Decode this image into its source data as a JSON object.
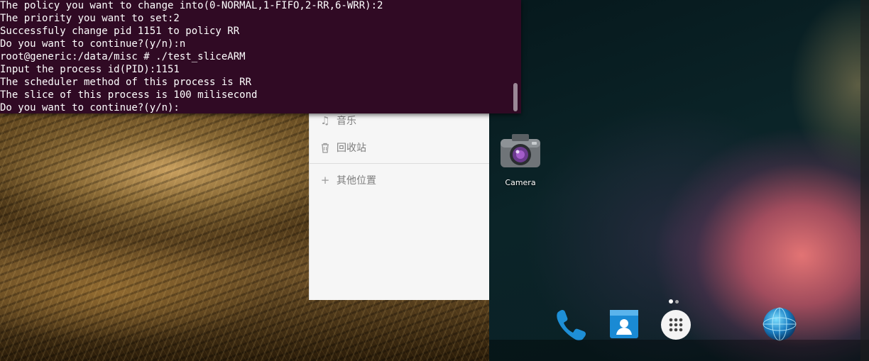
{
  "terminal": {
    "lines": [
      "The policy you want to change into(0-NORMAL,1-FIFO,2-RR,6-WRR):2",
      "The priority you want to set:2",
      "Successfuly change pid 1151 to policy RR",
      "Do you want to continue?(y/n):n",
      "root@generic:/data/misc # ./test_sliceARM",
      "Input the process id(PID):1151",
      "The scheduler method of this process is RR",
      "The slice of this process is 100 milisecond",
      "Do you want to continue?(y/n):"
    ],
    "background": "#300a24"
  },
  "file_manager": {
    "items": [
      {
        "label": "音乐",
        "icon": "music-note-icon"
      },
      {
        "label": "回收站",
        "icon": "trash-icon"
      },
      {
        "label": "其他位置",
        "icon": "plus-icon"
      }
    ]
  },
  "android": {
    "apps": [
      {
        "label": "Camera",
        "icon": "camera-icon"
      }
    ],
    "dock": [
      {
        "icon": "phone-icon"
      },
      {
        "icon": "contacts-icon"
      },
      {
        "icon": "all-apps-icon"
      },
      {
        "icon": "browser-globe-icon"
      }
    ],
    "page_indicator": {
      "pages": 2,
      "current": 1
    }
  }
}
